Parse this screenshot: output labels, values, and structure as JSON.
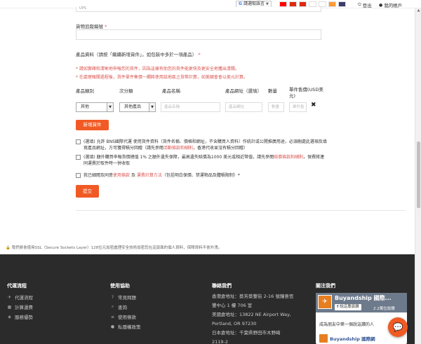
{
  "topbar": {
    "language_button": "請選取語言",
    "flags": [
      {
        "name": "taiwan",
        "color": "#fe0000"
      },
      {
        "name": "hong-kong",
        "color": "#de2910"
      },
      {
        "name": "china",
        "color": "#de2910"
      },
      {
        "name": "japan",
        "color": "#ffffff"
      },
      {
        "name": "korea",
        "color": "#ffffff"
      },
      {
        "name": "india",
        "color": "#ff9933"
      },
      {
        "name": "usa",
        "color": "#3c3b6e"
      }
    ],
    "logout": "登出",
    "my_account": "我的帳戶"
  },
  "form": {
    "shipping_method_value": "UPS",
    "tracking_label": "貨物追蹤編號",
    "tracking_value": "",
    "product_section_label": "產品資料（請按「繼續新增貨件」，如包裝中多於一項產品）",
    "notes": [
      "* 請如實確和清晰地申報您的貨件，因為這樣有助您的貨件能更快及更安全地獲出清關。",
      "* 在處理報關過程後，貨件單件售價一欄將使用該地區之貨幣計算，如美國會會以美元計算。"
    ],
    "table_headers": {
      "category": "產品類別",
      "subcategory": "次分類",
      "name": "產品名稱",
      "url": "產品網址（選填）",
      "qty": "數量",
      "price": "單件售價(USD美元)"
    },
    "row": {
      "category": "其他",
      "subcategory": "其他產品",
      "name_placeholder": "產品名稱",
      "url_placeholder": "產品網址",
      "qty_placeholder": "數量",
      "price_placeholder": "單件售價"
    },
    "add_item_button": "新增貨件",
    "checkboxes": [
      {
        "text": "(選填) 允許 BNS國際代運 使用貨件資料（貨件名稱、價格和網址，不含購買人資料）作統計或公開推廣用途，必須刪處此選項及填寫產品網址，方可獲得積分回贈（請先參閱",
        "link": "活動條款和細則",
        "text2": "，香港代收並沒有積分回贈）"
      },
      {
        "text": "(選填) 額外購買申報貨價總值 1% 之額外遺失保障，最高遺失賠償為1000 美元或相近幣值，請先參閱",
        "link": "賠償條款和細則",
        "text2": "，保費將連同運費於取件時一併收取"
      },
      {
        "text": "我已細閱及同意",
        "link": "使用條款",
        "text2": " 及 ",
        "link2": "運費計算方法",
        "text3": "（包括明白保價、禁運物品及體積限制）*"
      }
    ],
    "submit_button": "提交"
  },
  "ssl_note": "我們將會使用SSL（Secure Sockets Layer）128位元加密處理安全技術加密您在這頁面的個人資料，保障資料不會外洩。",
  "footer": {
    "col1": {
      "heading": "代運流程",
      "items": [
        {
          "icon": "plane-icon",
          "glyph": "✈",
          "label": "代運流程"
        },
        {
          "icon": "calculator-icon",
          "glyph": "▦",
          "label": "計算運費"
        },
        {
          "icon": "cube-icon",
          "glyph": "◈",
          "label": "服務優勢"
        }
      ]
    },
    "col2": {
      "heading": "使用協助",
      "items": [
        {
          "icon": "question-icon",
          "glyph": "?",
          "label": "常見問題"
        },
        {
          "icon": "search-icon",
          "glyph": "⌕",
          "label": "查詢"
        },
        {
          "icon": "terms-icon",
          "glyph": "≡",
          "label": "使用條款"
        },
        {
          "icon": "user-icon",
          "glyph": "●",
          "label": "私隱權政策"
        }
      ]
    },
    "col3": {
      "heading": "聯絡我們",
      "lines": [
        "香港倉地址：葵芳葵豐街 2-16 號鐘意恆",
        "豐中心 1 樓 706 室",
        "美國倉地址：13822 NE Airport Way,",
        "Portland, OR 97230",
        "日本倉地址：千葉県野田市木野崎",
        "2119-2"
      ]
    },
    "col4": {
      "heading": "關注我們",
      "fb_name": "Buyandship 國際...",
      "fb_like": "說這專頁讚",
      "fb_count": "2.2萬位說讚",
      "fb_friends": "成為朋友中第一個說這讚的人",
      "fb_post_name": "Buyandship 國際網"
    }
  }
}
